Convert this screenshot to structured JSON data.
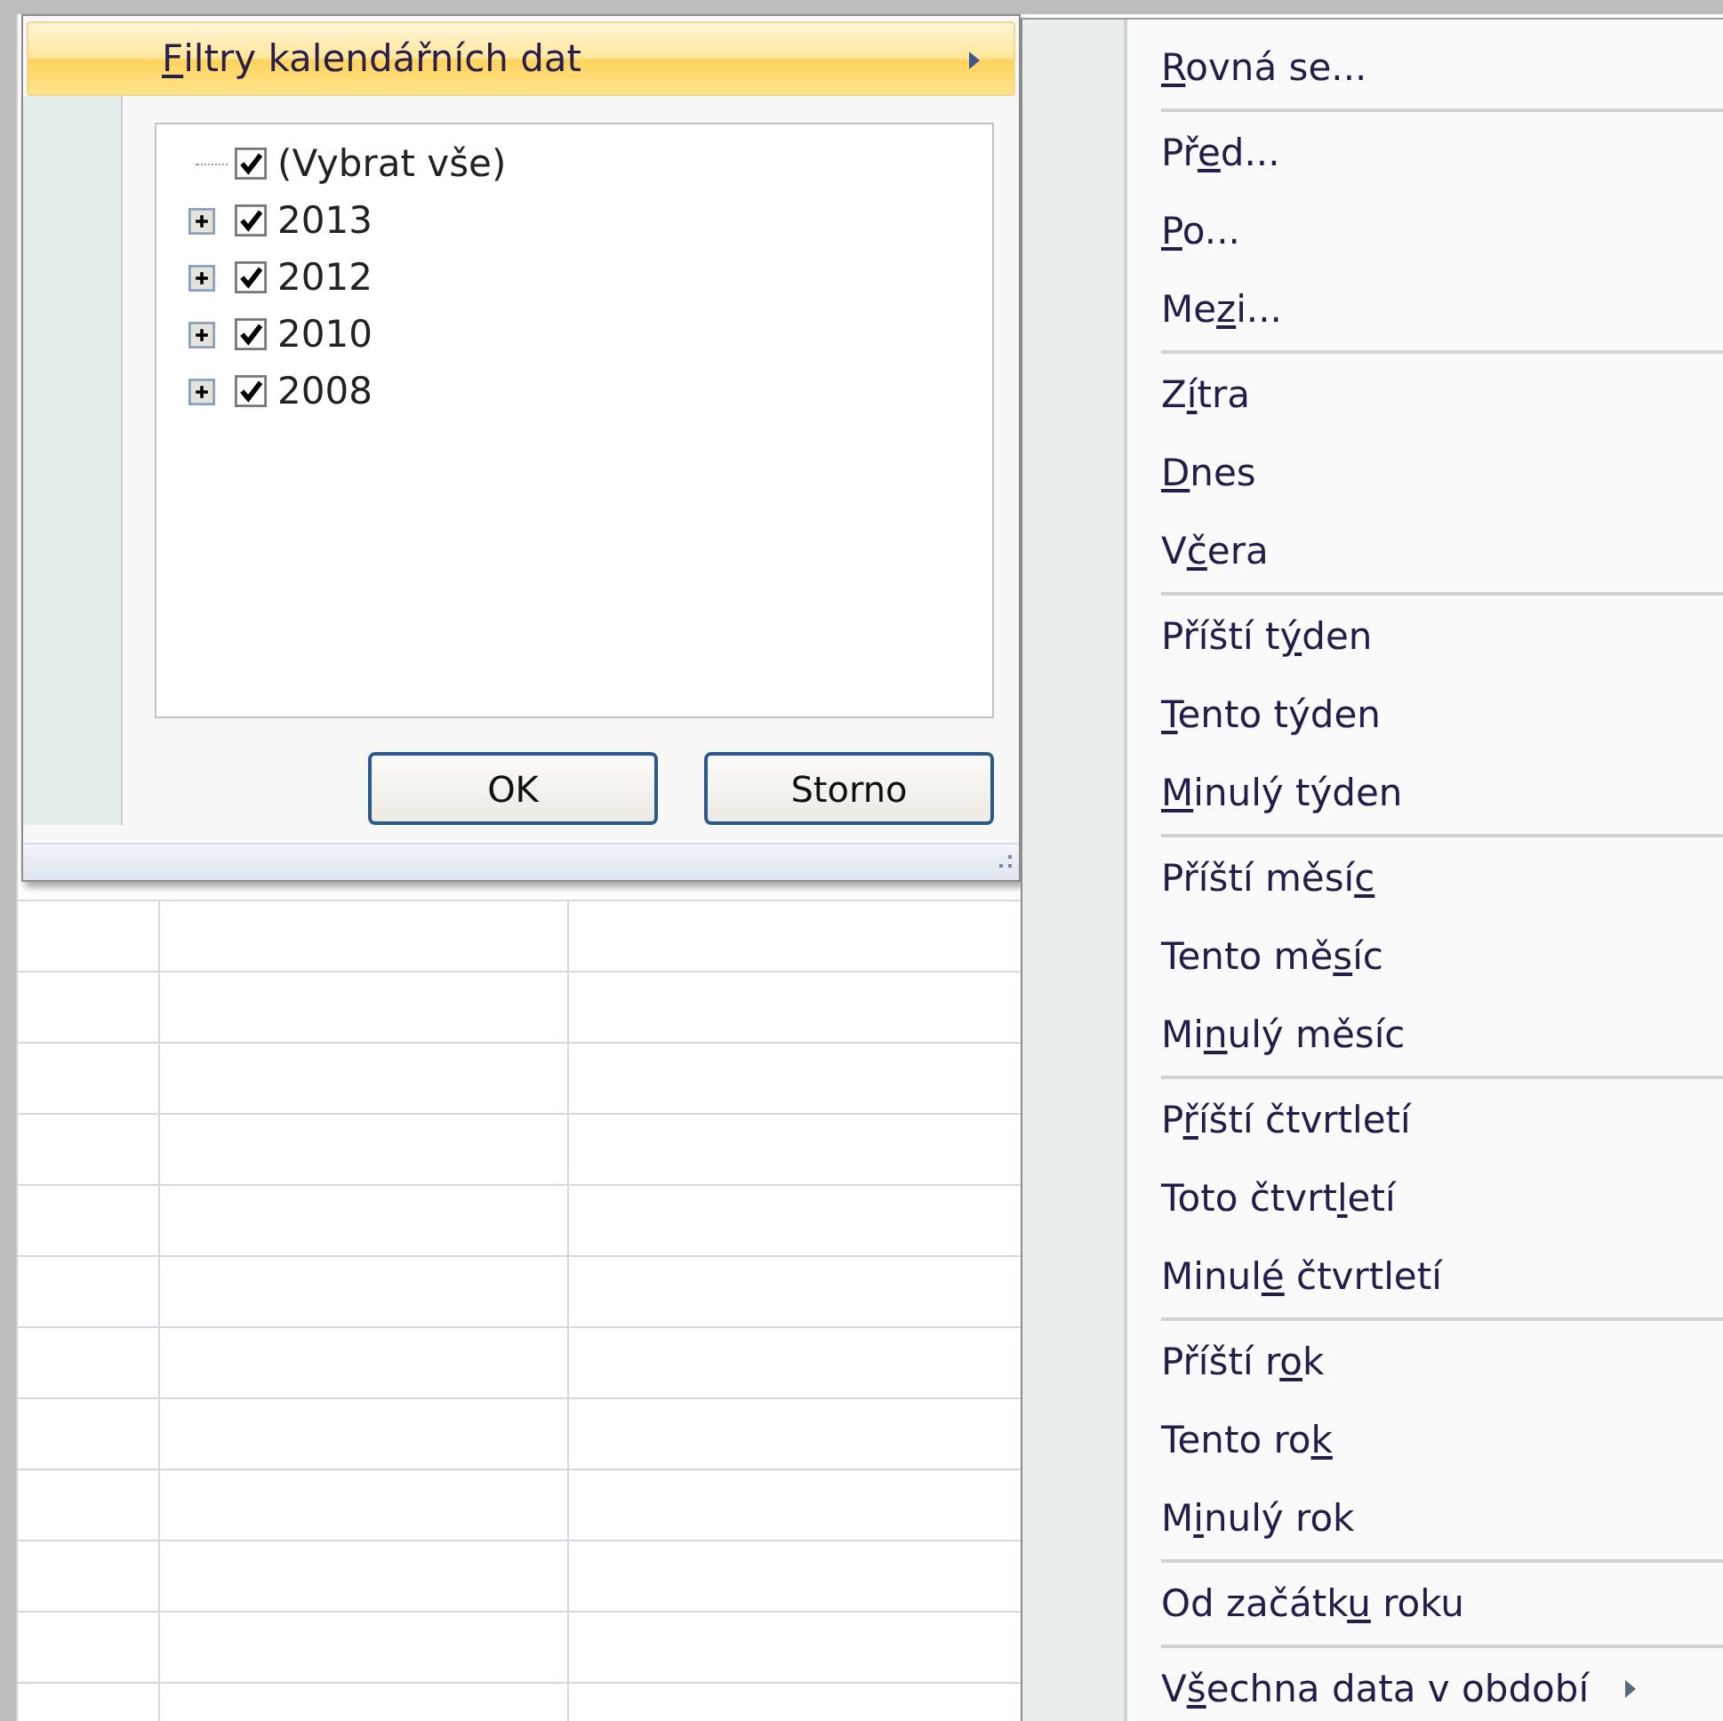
{
  "filter_popup": {
    "menu_item": {
      "key": "F",
      "post": "iltry kalendářních dat",
      "selected": true,
      "submenu": true
    },
    "tree": [
      {
        "kind": "select_all",
        "label": "(Vybrat vše)",
        "checked": true
      },
      {
        "kind": "group",
        "label": "2013",
        "checked": true,
        "expanded": false
      },
      {
        "kind": "group",
        "label": "2012",
        "checked": true,
        "expanded": false
      },
      {
        "kind": "group",
        "label": "2010",
        "checked": true,
        "expanded": false
      },
      {
        "kind": "group",
        "label": "2008",
        "checked": true,
        "expanded": false
      }
    ],
    "buttons": [
      "OK",
      "Storno"
    ]
  },
  "date_filters_menu": {
    "groups": [
      [
        {
          "key": "R",
          "post": "ovná se...",
          "submenu": false
        }
      ],
      [
        {
          "pre": "Př",
          "key": "e",
          "post": "d...",
          "submenu": false
        },
        {
          "key": "P",
          "post": "o...",
          "submenu": false
        },
        {
          "pre": "Me",
          "key": "z",
          "post": "i...",
          "submenu": false
        }
      ],
      [
        {
          "pre": "Z",
          "key": "í",
          "post": "tra",
          "submenu": false
        },
        {
          "key": "D",
          "post": "nes",
          "submenu": false
        },
        {
          "pre": "V",
          "key": "č",
          "post": "era",
          "submenu": false
        }
      ],
      [
        {
          "pre": "Příští t",
          "key": "ý",
          "post": "den",
          "submenu": false
        },
        {
          "key": "T",
          "post": "ento týden",
          "submenu": false
        },
        {
          "key": "M",
          "post": "inulý týden",
          "submenu": false
        }
      ],
      [
        {
          "pre": "Příští měsí",
          "key": "c",
          "submenu": false
        },
        {
          "pre": "Tento mě",
          "key": "s",
          "post": "íc",
          "submenu": false
        },
        {
          "pre": "Mi",
          "key": "n",
          "post": "ulý měsíc",
          "submenu": false
        }
      ],
      [
        {
          "pre": "P",
          "key": "ř",
          "post": "íští čtvrtletí",
          "submenu": false
        },
        {
          "pre": "Toto čtvrt",
          "key": "l",
          "post": "etí",
          "submenu": false
        },
        {
          "pre": "Minul",
          "key": "é",
          "post": " čtvrtletí",
          "submenu": false
        }
      ],
      [
        {
          "pre": "Příští r",
          "key": "o",
          "post": "k",
          "submenu": false
        },
        {
          "pre": "Tento ro",
          "key": "k",
          "submenu": false
        },
        {
          "pre": "M",
          "key": "i",
          "post": "nulý rok",
          "submenu": false
        }
      ],
      [
        {
          "pre": "Od začátk",
          "key": "u",
          "post": " roku",
          "submenu": false
        }
      ],
      [
        {
          "pre": "V",
          "key": "š",
          "post": "echna data v období",
          "submenu": true
        }
      ]
    ]
  }
}
